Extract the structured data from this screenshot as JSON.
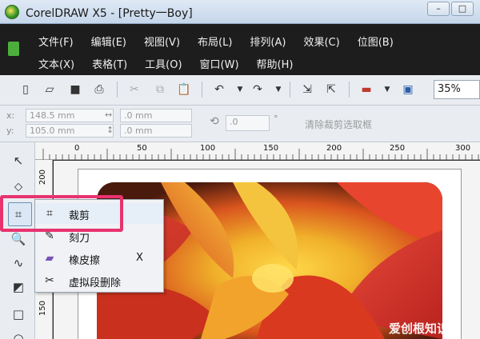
{
  "window": {
    "title": "CorelDRAW X5 - [Pretty一Boy]"
  },
  "menu": {
    "row1": [
      "文件(F)",
      "编辑(E)",
      "视图(V)",
      "布局(L)",
      "排列(A)",
      "效果(C)",
      "位图(B)"
    ],
    "row2": [
      "文本(X)",
      "表格(T)",
      "工具(O)",
      "窗口(W)",
      "帮助(H)"
    ]
  },
  "toolbar": {
    "zoom": "35%"
  },
  "property_bar": {
    "x_label": "x:",
    "x_value": "148.5 mm",
    "y_label": "y:",
    "y_value": "105.0 mm",
    "w_value": ".0 mm",
    "h_value": ".0 mm",
    "angle_value": ".0",
    "angle_unit": "°",
    "clear_crop": "清除裁剪选取框"
  },
  "ruler": {
    "top": [
      "0",
      "50",
      "100",
      "150",
      "200",
      "250",
      "300"
    ],
    "left": [
      "200",
      "150"
    ]
  },
  "flyout": {
    "items": [
      {
        "label": "裁剪",
        "shortcut": ""
      },
      {
        "label": "刻刀",
        "shortcut": ""
      },
      {
        "label": "橡皮擦",
        "shortcut": "X"
      },
      {
        "label": "虚拟段删除",
        "shortcut": ""
      }
    ]
  },
  "watermark": "爱创根知识网",
  "colors": {
    "highlight": "#e8336f",
    "menubar": "#1d1d1d"
  }
}
